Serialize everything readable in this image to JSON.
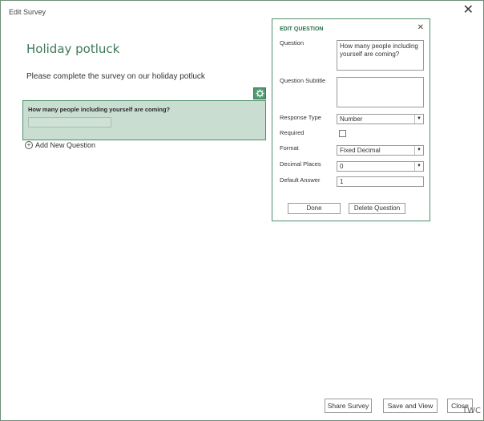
{
  "window": {
    "title": "Edit Survey",
    "close_glyph": "✕"
  },
  "survey": {
    "title": "Holiday potluck",
    "description": "Please complete the survey on our holiday potluck"
  },
  "question_card": {
    "text": "How many people including yourself are coming?",
    "answer_value": ""
  },
  "add_question_label": "Add New Question",
  "edit_panel": {
    "header": "EDIT QUESTION",
    "close_glyph": "✕",
    "question_label": "Question",
    "question_value": "How many people including yourself are coming?",
    "subtitle_label": "Question Subtitle",
    "subtitle_value": "",
    "response_type_label": "Response Type",
    "response_type_value": "Number",
    "required_label": "Required",
    "required_checked": false,
    "format_label": "Format",
    "format_value": "Fixed Decimal",
    "decimal_places_label": "Decimal Places",
    "decimal_places_value": "0",
    "default_answer_label": "Default Answer",
    "default_answer_value": "1",
    "done_label": "Done",
    "delete_label": "Delete Question"
  },
  "footer": {
    "share_label": "Share Survey",
    "save_view_label": "Save and View",
    "close_label": "Close"
  },
  "watermark": "TWC",
  "colors": {
    "accent": "#3d7a58",
    "card_bg": "#c9ddd1",
    "gear_bg": "#4f9a70"
  },
  "icons": {
    "gear": "gear-icon",
    "plus": "plus-circle-icon",
    "dropdown": "chevron-down-icon"
  }
}
